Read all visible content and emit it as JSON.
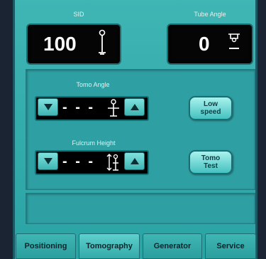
{
  "sid": {
    "label": "SID",
    "value": "100"
  },
  "tube_angle": {
    "label": "Tube Angle",
    "value": "0"
  },
  "tomo_angle": {
    "label": "Tomo Angle",
    "value": "- - -"
  },
  "fulcrum_height": {
    "label": "Fulcrum Height",
    "value": "- - -"
  },
  "buttons": {
    "low_speed": "Low\nspeed",
    "tomo_test": "Tomo\nTest"
  },
  "tabs": [
    {
      "label": "Positioning"
    },
    {
      "label": "Tomography"
    },
    {
      "label": "Generator"
    },
    {
      "label": "Service"
    }
  ],
  "active_tab": "Tomography",
  "colors": {
    "panel": "#3fb5b4",
    "display_bg": "#050505",
    "text_on_display": "#ffffff"
  },
  "icons": [
    "tube-stand-icon",
    "tube-angle-icon",
    "tomo-angle-icon",
    "fulcrum-height-icon",
    "arrow-down-icon",
    "arrow-up-icon"
  ]
}
